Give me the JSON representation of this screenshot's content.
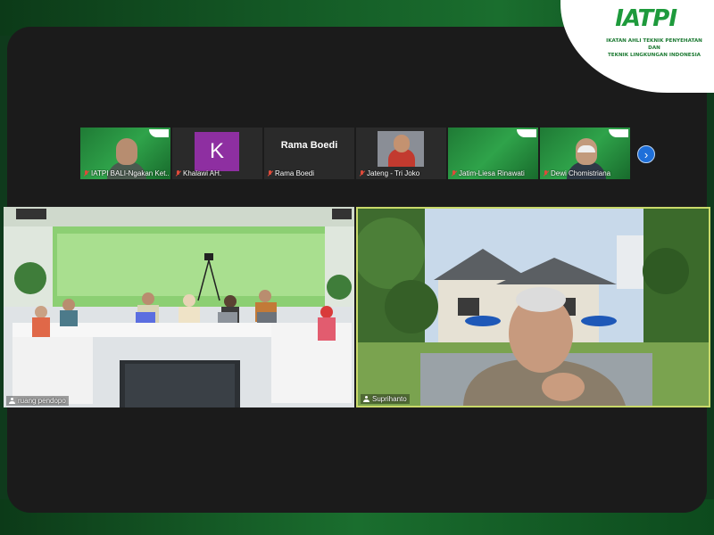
{
  "logo": {
    "mark": "IATPI",
    "caption_line1": "IKATAN AHLI TEKNIK PENYEHATAN DAN",
    "caption_line2": "TEKNIK LINGKUNGAN INDONESIA"
  },
  "participants": [
    {
      "name": "IATPI BALI-Ngakan Ket...",
      "type": "video",
      "muted": true
    },
    {
      "name": "Khalawi AH.",
      "type": "avatar",
      "initial": "K",
      "muted": true
    },
    {
      "name": "Rama Boedi",
      "type": "name-card",
      "card_text": "Rama Boedi",
      "muted": true
    },
    {
      "name": "Jateng - Tri Joko",
      "type": "video",
      "muted": true
    },
    {
      "name": "Jatim-Liesa Rinawati",
      "type": "video",
      "muted": true
    },
    {
      "name": "Dewi Chomistriana",
      "type": "video",
      "muted": true
    }
  ],
  "next_button_icon": "chevron-right-icon",
  "main_tiles": [
    {
      "name": "ruang pendopo"
    },
    {
      "name": "Suprihanto"
    }
  ],
  "colors": {
    "frame_green": "#155d27",
    "screen_bg": "#1b1b1b",
    "active_speaker_border": "#c9d96a",
    "next_button": "#1e6fd9",
    "avatar_purple": "#8e2fa1",
    "mute_red": "#e04a3a"
  }
}
